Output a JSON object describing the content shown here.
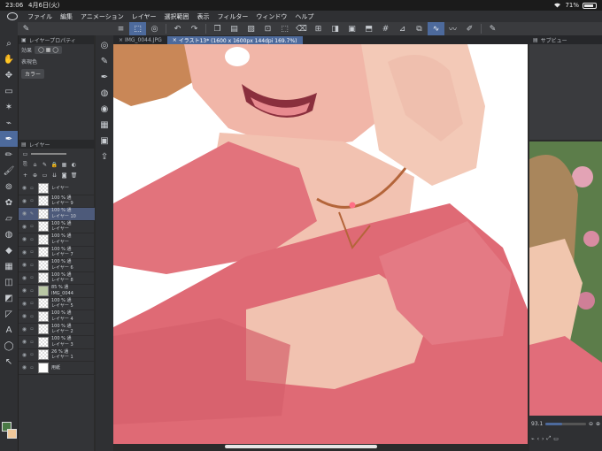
{
  "status": {
    "time": "23:06",
    "date": "4月6日(火)",
    "battery": "71%",
    "wifi_icon": "wifi-icon"
  },
  "menu": [
    "ファイル",
    "編集",
    "アニメーション",
    "レイヤー",
    "選択範囲",
    "表示",
    "フィルター",
    "ウィンドウ",
    "ヘルプ"
  ],
  "tabs": [
    {
      "label": "IMG_0044.JPG",
      "active": false
    },
    {
      "label": "イラスト13* (1600 x 1600px 144dpi 169.7%)",
      "active": true
    }
  ],
  "property_panel": {
    "title": "レイヤープロパティ",
    "effect_label": "効果",
    "expression_label": "表現色",
    "color_value": "カラー"
  },
  "layer_panel": {
    "title": "レイヤー"
  },
  "layers": [
    {
      "opacity": "",
      "name": "レイヤー",
      "selected": false
    },
    {
      "opacity": "100 % 通",
      "name": "レイヤー 9",
      "selected": false
    },
    {
      "opacity": "100 % 通",
      "name": "レイヤー 10",
      "selected": true
    },
    {
      "opacity": "100 % 通",
      "name": "レイヤー",
      "selected": false
    },
    {
      "opacity": "100 % 通",
      "name": "レイヤー",
      "selected": false
    },
    {
      "opacity": "100 % 通",
      "name": "レイヤー 7",
      "selected": false
    },
    {
      "opacity": "100 % 通",
      "name": "レイヤー 6",
      "selected": false
    },
    {
      "opacity": "100 % 通",
      "name": "レイヤー 8",
      "selected": false
    },
    {
      "opacity": "85 % 通",
      "name": "IMG_0044",
      "selected": false
    },
    {
      "opacity": "100 % 通",
      "name": "レイヤー 5",
      "selected": false
    },
    {
      "opacity": "100 % 通",
      "name": "レイヤー 4",
      "selected": false
    },
    {
      "opacity": "100 % 通",
      "name": "レイヤー 2",
      "selected": false
    },
    {
      "opacity": "100 % 通",
      "name": "レイヤー 3",
      "selected": false
    },
    {
      "opacity": "26 % 通",
      "name": "レイヤー 1",
      "selected": false
    },
    {
      "opacity": "",
      "name": "用紙",
      "selected": false
    }
  ],
  "subview": {
    "title": "サブビュー",
    "zoom": "93.1"
  },
  "colors": {
    "main": "#4a7a45",
    "sub": "#f0c89a",
    "accent": "#4d6a9c"
  }
}
